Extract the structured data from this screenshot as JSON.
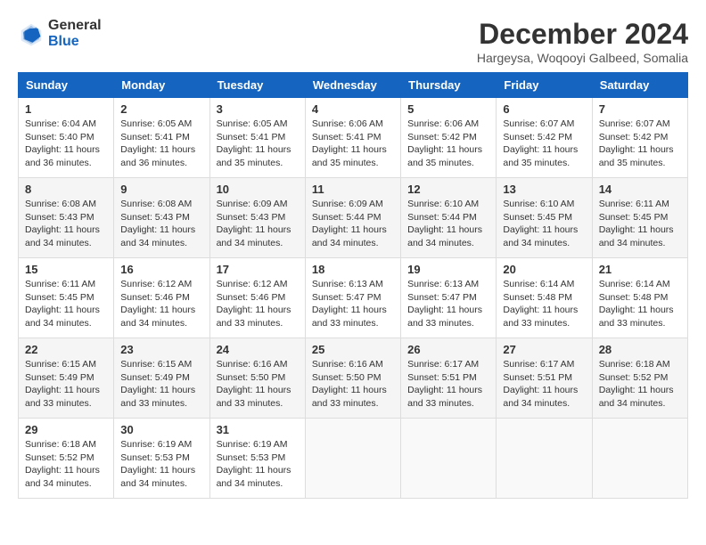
{
  "header": {
    "logo_general": "General",
    "logo_blue": "Blue",
    "month_title": "December 2024",
    "location": "Hargeysa, Woqooyi Galbeed, Somalia"
  },
  "weekdays": [
    "Sunday",
    "Monday",
    "Tuesday",
    "Wednesday",
    "Thursday",
    "Friday",
    "Saturday"
  ],
  "weeks": [
    [
      {
        "day": "1",
        "sunrise": "6:04 AM",
        "sunset": "5:40 PM",
        "daylight": "11 hours and 36 minutes."
      },
      {
        "day": "2",
        "sunrise": "6:05 AM",
        "sunset": "5:41 PM",
        "daylight": "11 hours and 36 minutes."
      },
      {
        "day": "3",
        "sunrise": "6:05 AM",
        "sunset": "5:41 PM",
        "daylight": "11 hours and 35 minutes."
      },
      {
        "day": "4",
        "sunrise": "6:06 AM",
        "sunset": "5:41 PM",
        "daylight": "11 hours and 35 minutes."
      },
      {
        "day": "5",
        "sunrise": "6:06 AM",
        "sunset": "5:42 PM",
        "daylight": "11 hours and 35 minutes."
      },
      {
        "day": "6",
        "sunrise": "6:07 AM",
        "sunset": "5:42 PM",
        "daylight": "11 hours and 35 minutes."
      },
      {
        "day": "7",
        "sunrise": "6:07 AM",
        "sunset": "5:42 PM",
        "daylight": "11 hours and 35 minutes."
      }
    ],
    [
      {
        "day": "8",
        "sunrise": "6:08 AM",
        "sunset": "5:43 PM",
        "daylight": "11 hours and 34 minutes."
      },
      {
        "day": "9",
        "sunrise": "6:08 AM",
        "sunset": "5:43 PM",
        "daylight": "11 hours and 34 minutes."
      },
      {
        "day": "10",
        "sunrise": "6:09 AM",
        "sunset": "5:43 PM",
        "daylight": "11 hours and 34 minutes."
      },
      {
        "day": "11",
        "sunrise": "6:09 AM",
        "sunset": "5:44 PM",
        "daylight": "11 hours and 34 minutes."
      },
      {
        "day": "12",
        "sunrise": "6:10 AM",
        "sunset": "5:44 PM",
        "daylight": "11 hours and 34 minutes."
      },
      {
        "day": "13",
        "sunrise": "6:10 AM",
        "sunset": "5:45 PM",
        "daylight": "11 hours and 34 minutes."
      },
      {
        "day": "14",
        "sunrise": "6:11 AM",
        "sunset": "5:45 PM",
        "daylight": "11 hours and 34 minutes."
      }
    ],
    [
      {
        "day": "15",
        "sunrise": "6:11 AM",
        "sunset": "5:45 PM",
        "daylight": "11 hours and 34 minutes."
      },
      {
        "day": "16",
        "sunrise": "6:12 AM",
        "sunset": "5:46 PM",
        "daylight": "11 hours and 34 minutes."
      },
      {
        "day": "17",
        "sunrise": "6:12 AM",
        "sunset": "5:46 PM",
        "daylight": "11 hours and 33 minutes."
      },
      {
        "day": "18",
        "sunrise": "6:13 AM",
        "sunset": "5:47 PM",
        "daylight": "11 hours and 33 minutes."
      },
      {
        "day": "19",
        "sunrise": "6:13 AM",
        "sunset": "5:47 PM",
        "daylight": "11 hours and 33 minutes."
      },
      {
        "day": "20",
        "sunrise": "6:14 AM",
        "sunset": "5:48 PM",
        "daylight": "11 hours and 33 minutes."
      },
      {
        "day": "21",
        "sunrise": "6:14 AM",
        "sunset": "5:48 PM",
        "daylight": "11 hours and 33 minutes."
      }
    ],
    [
      {
        "day": "22",
        "sunrise": "6:15 AM",
        "sunset": "5:49 PM",
        "daylight": "11 hours and 33 minutes."
      },
      {
        "day": "23",
        "sunrise": "6:15 AM",
        "sunset": "5:49 PM",
        "daylight": "11 hours and 33 minutes."
      },
      {
        "day": "24",
        "sunrise": "6:16 AM",
        "sunset": "5:50 PM",
        "daylight": "11 hours and 33 minutes."
      },
      {
        "day": "25",
        "sunrise": "6:16 AM",
        "sunset": "5:50 PM",
        "daylight": "11 hours and 33 minutes."
      },
      {
        "day": "26",
        "sunrise": "6:17 AM",
        "sunset": "5:51 PM",
        "daylight": "11 hours and 33 minutes."
      },
      {
        "day": "27",
        "sunrise": "6:17 AM",
        "sunset": "5:51 PM",
        "daylight": "11 hours and 34 minutes."
      },
      {
        "day": "28",
        "sunrise": "6:18 AM",
        "sunset": "5:52 PM",
        "daylight": "11 hours and 34 minutes."
      }
    ],
    [
      {
        "day": "29",
        "sunrise": "6:18 AM",
        "sunset": "5:52 PM",
        "daylight": "11 hours and 34 minutes."
      },
      {
        "day": "30",
        "sunrise": "6:19 AM",
        "sunset": "5:53 PM",
        "daylight": "11 hours and 34 minutes."
      },
      {
        "day": "31",
        "sunrise": "6:19 AM",
        "sunset": "5:53 PM",
        "daylight": "11 hours and 34 minutes."
      },
      null,
      null,
      null,
      null
    ]
  ]
}
